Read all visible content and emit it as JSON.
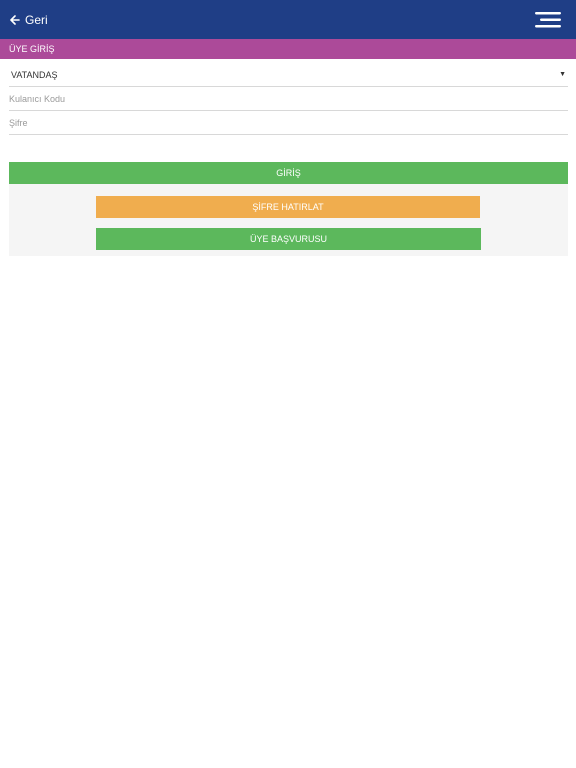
{
  "header": {
    "back_label": "Geri",
    "back_icon": "arrow-left-icon",
    "menu_icon": "hamburger-menu-icon",
    "background": "#1f3e86"
  },
  "section": {
    "title": "ÜYE GİRİŞ",
    "background": "#ac4a99"
  },
  "form": {
    "user_type": {
      "selected": "VATANDAŞ"
    },
    "username": {
      "placeholder": "Kulanıcı Kodu",
      "value": ""
    },
    "password": {
      "placeholder": "Şifre",
      "value": ""
    }
  },
  "actions": {
    "login_label": "GİRİŞ",
    "remind_password_label": "ŞİFRE HATIRLAT",
    "register_label": "ÜYE BAŞVURUSU"
  },
  "colors": {
    "success": "#5cb85c",
    "warning": "#f0ad4e"
  }
}
